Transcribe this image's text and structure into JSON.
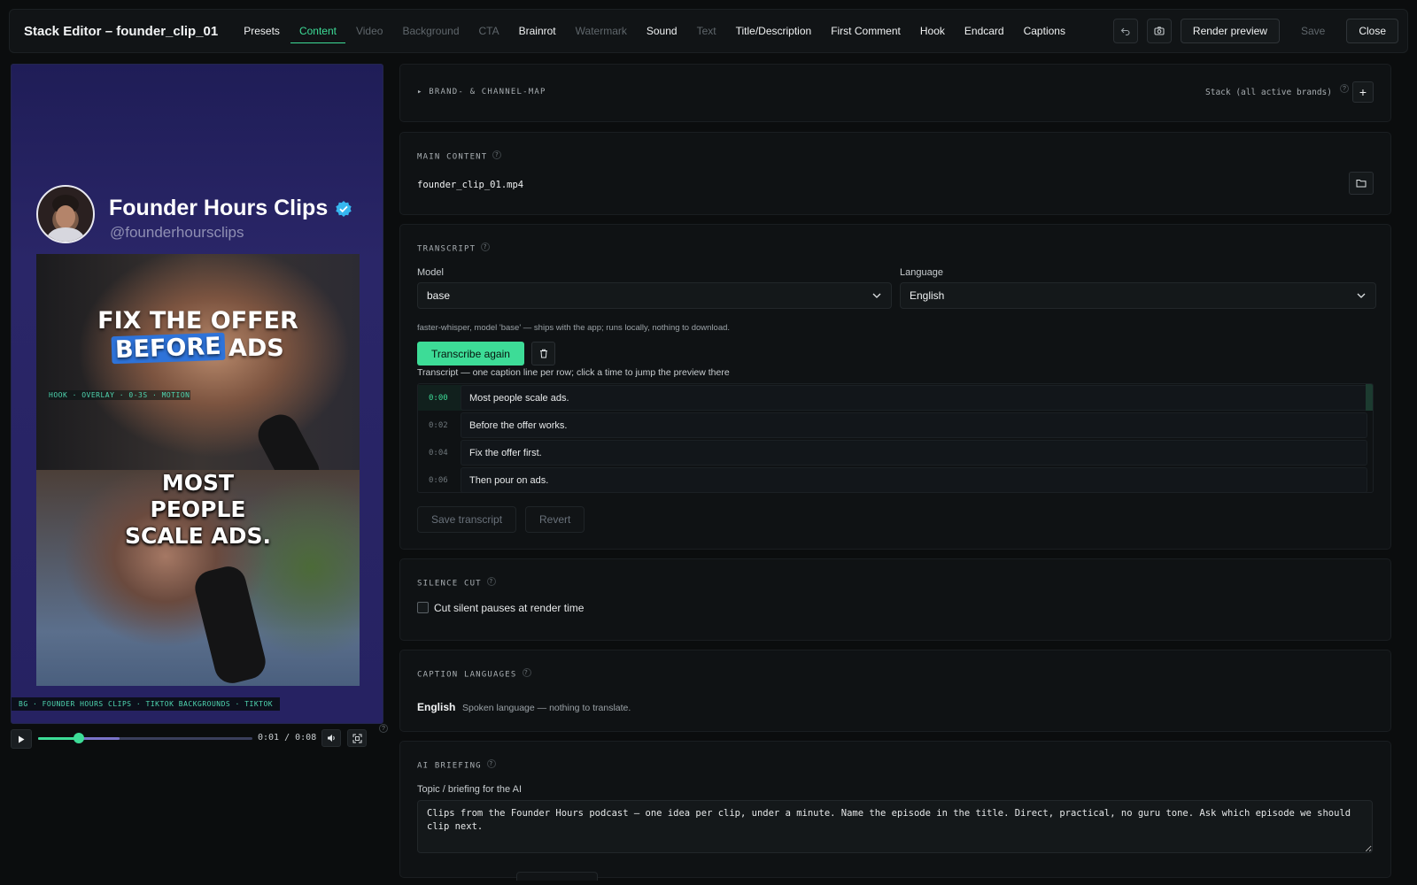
{
  "app": {
    "title": "Stack Editor – founder_clip_01"
  },
  "tabs": [
    {
      "label": "Presets",
      "state": "normal"
    },
    {
      "label": "Content",
      "state": "active"
    },
    {
      "label": "Video",
      "state": "dim"
    },
    {
      "label": "Background",
      "state": "dim"
    },
    {
      "label": "CTA",
      "state": "dim"
    },
    {
      "label": "Brainrot",
      "state": "normal"
    },
    {
      "label": "Watermark",
      "state": "dim"
    },
    {
      "label": "Sound",
      "state": "normal"
    },
    {
      "label": "Text",
      "state": "dim"
    },
    {
      "label": "Title/Description",
      "state": "normal"
    },
    {
      "label": "First Comment",
      "state": "normal"
    },
    {
      "label": "Hook",
      "state": "normal"
    },
    {
      "label": "Endcard",
      "state": "normal"
    },
    {
      "label": "Captions",
      "state": "normal"
    }
  ],
  "toolbar": {
    "undo_icon": "undo-icon",
    "snapshot_icon": "camera-icon",
    "render_label": "Render preview",
    "save_label": "Save",
    "close_label": "Close"
  },
  "preview": {
    "channel_name": "Founder Hours Clips",
    "channel_handle": "@founderhoursclips",
    "hook_line1": "FIX THE OFFER",
    "hook_highlight": "BEFORE",
    "hook_rest": "ADS",
    "overlay_tag": "HOOK · OVERLAY · 0-3S · MOTION",
    "caption_lines": [
      "MOST",
      "PEOPLE",
      "SCALE ADS."
    ],
    "bg_tag": "BG · FOUNDER HOURS CLIPS · TIKTOK BACKGROUNDS · TIKTOK",
    "time_display": "0:01 / 0:08",
    "progress": 0.19,
    "buffered": 0.38,
    "colors": {
      "accent": "#3ddc97",
      "highlight": "#2e73d9",
      "bg": "#262262"
    }
  },
  "brand_map": {
    "title": "▸ BRAND- & CHANNEL-MAP",
    "stack_label": "Stack (all active brands)",
    "add_label": "+"
  },
  "main_content": {
    "title": "MAIN CONTENT",
    "file": "founder_clip_01.mp4"
  },
  "transcript": {
    "title": "TRANSCRIPT",
    "model_label": "Model",
    "model_value": "base",
    "language_label": "Language",
    "language_value": "English",
    "hint": "faster-whisper, model 'base' — ships with the app; runs locally, nothing to download.",
    "transcribe_label": "Transcribe again",
    "list_hint": "Transcript — one caption line per row; click a time to jump the preview there",
    "rows": [
      {
        "time": "0:00",
        "text": "Most people scale ads."
      },
      {
        "time": "0:02",
        "text": "Before the offer works."
      },
      {
        "time": "0:04",
        "text": "Fix the offer first."
      },
      {
        "time": "0:06",
        "text": "Then pour on ads."
      }
    ],
    "save_label": "Save transcript",
    "revert_label": "Revert"
  },
  "silence_cut": {
    "title": "SILENCE CUT",
    "checkbox_label": "Cut silent pauses at render time"
  },
  "caption_languages": {
    "title": "CAPTION LANGUAGES",
    "language": "English",
    "note": "Spoken language — nothing to translate."
  },
  "ai_briefing": {
    "title": "AI BRIEFING",
    "label": "Topic / briefing for the AI",
    "value": "Clips from the Founder Hours podcast — one idea per clip, under a minute. Name the episode in the title. Direct, practical, no guru tone. Ask which episode we should clip next."
  }
}
